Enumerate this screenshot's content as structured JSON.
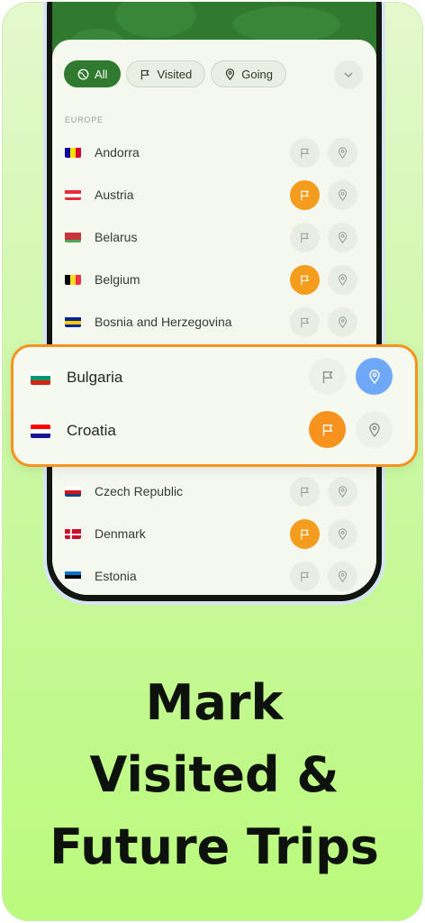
{
  "filters": [
    {
      "label": "All",
      "icon": "globe-icon",
      "active": true
    },
    {
      "label": "Visited",
      "icon": "flag-icon",
      "active": false
    },
    {
      "label": "Going",
      "icon": "pin-icon",
      "active": false
    }
  ],
  "section_label": "EUROPE",
  "countries_top": [
    {
      "name": "Andorra",
      "visited": false,
      "going": false
    },
    {
      "name": "Austria",
      "visited": true,
      "going": false
    },
    {
      "name": "Belarus",
      "visited": false,
      "going": false
    },
    {
      "name": "Belgium",
      "visited": true,
      "going": false
    },
    {
      "name": "Bosnia and Herzegovina",
      "visited": false,
      "going": false
    }
  ],
  "highlighted": [
    {
      "name": "Bulgaria",
      "visited": false,
      "going": true
    },
    {
      "name": "Croatia",
      "visited": true,
      "going": false
    }
  ],
  "countries_bottom": [
    {
      "name": "Czech Republic",
      "visited": false,
      "going": false
    },
    {
      "name": "Denmark",
      "visited": true,
      "going": false
    },
    {
      "name": "Estonia",
      "visited": false,
      "going": false
    }
  ],
  "headline": {
    "line1": "Mark",
    "line2": "Visited &",
    "line3": "Future Trips"
  },
  "colors": {
    "accent_green": "#2f7a2e",
    "visited_orange": "#f39c1d",
    "going_blue": "#6fa8f6",
    "highlight_border": "#f7921e"
  }
}
